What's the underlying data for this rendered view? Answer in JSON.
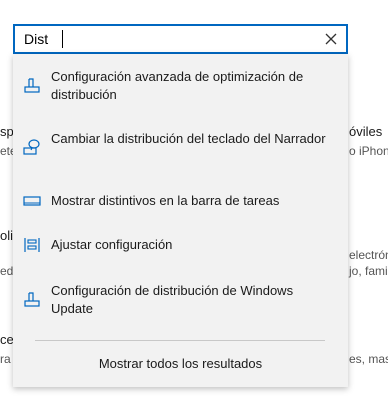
{
  "search": {
    "value": "Dist"
  },
  "results": [
    {
      "label": "Configuración avanzada de optimización de distribución",
      "icon": "delivery-optimization-icon"
    },
    {
      "label": "Cambiar la distribución del teclado del Narrador",
      "icon": "narrator-keyboard-icon"
    },
    {
      "label": "Mostrar distintivos en la barra de tareas",
      "icon": "taskbar-icon"
    },
    {
      "label": "Ajustar configuración",
      "icon": "adjust-settings-icon"
    },
    {
      "label": "Configuración de distribución de Windows Update",
      "icon": "windows-update-delivery-icon"
    }
  ],
  "show_all_label": "Mostrar todos los resultados",
  "background": {
    "frag1": "spo",
    "frag2": "ete",
    "frag3": "óviles",
    "frag4": "o iPhon",
    "frag5": "olic",
    "frag6": "ede",
    "frag7": "electróni",
    "frag8": "jo, famil",
    "frag9": "ce",
    "frag10": "ra",
    "frag11": "es, mas"
  },
  "colors": {
    "accent": "#0067c0",
    "dropdown_bg": "#f2f2f2"
  }
}
